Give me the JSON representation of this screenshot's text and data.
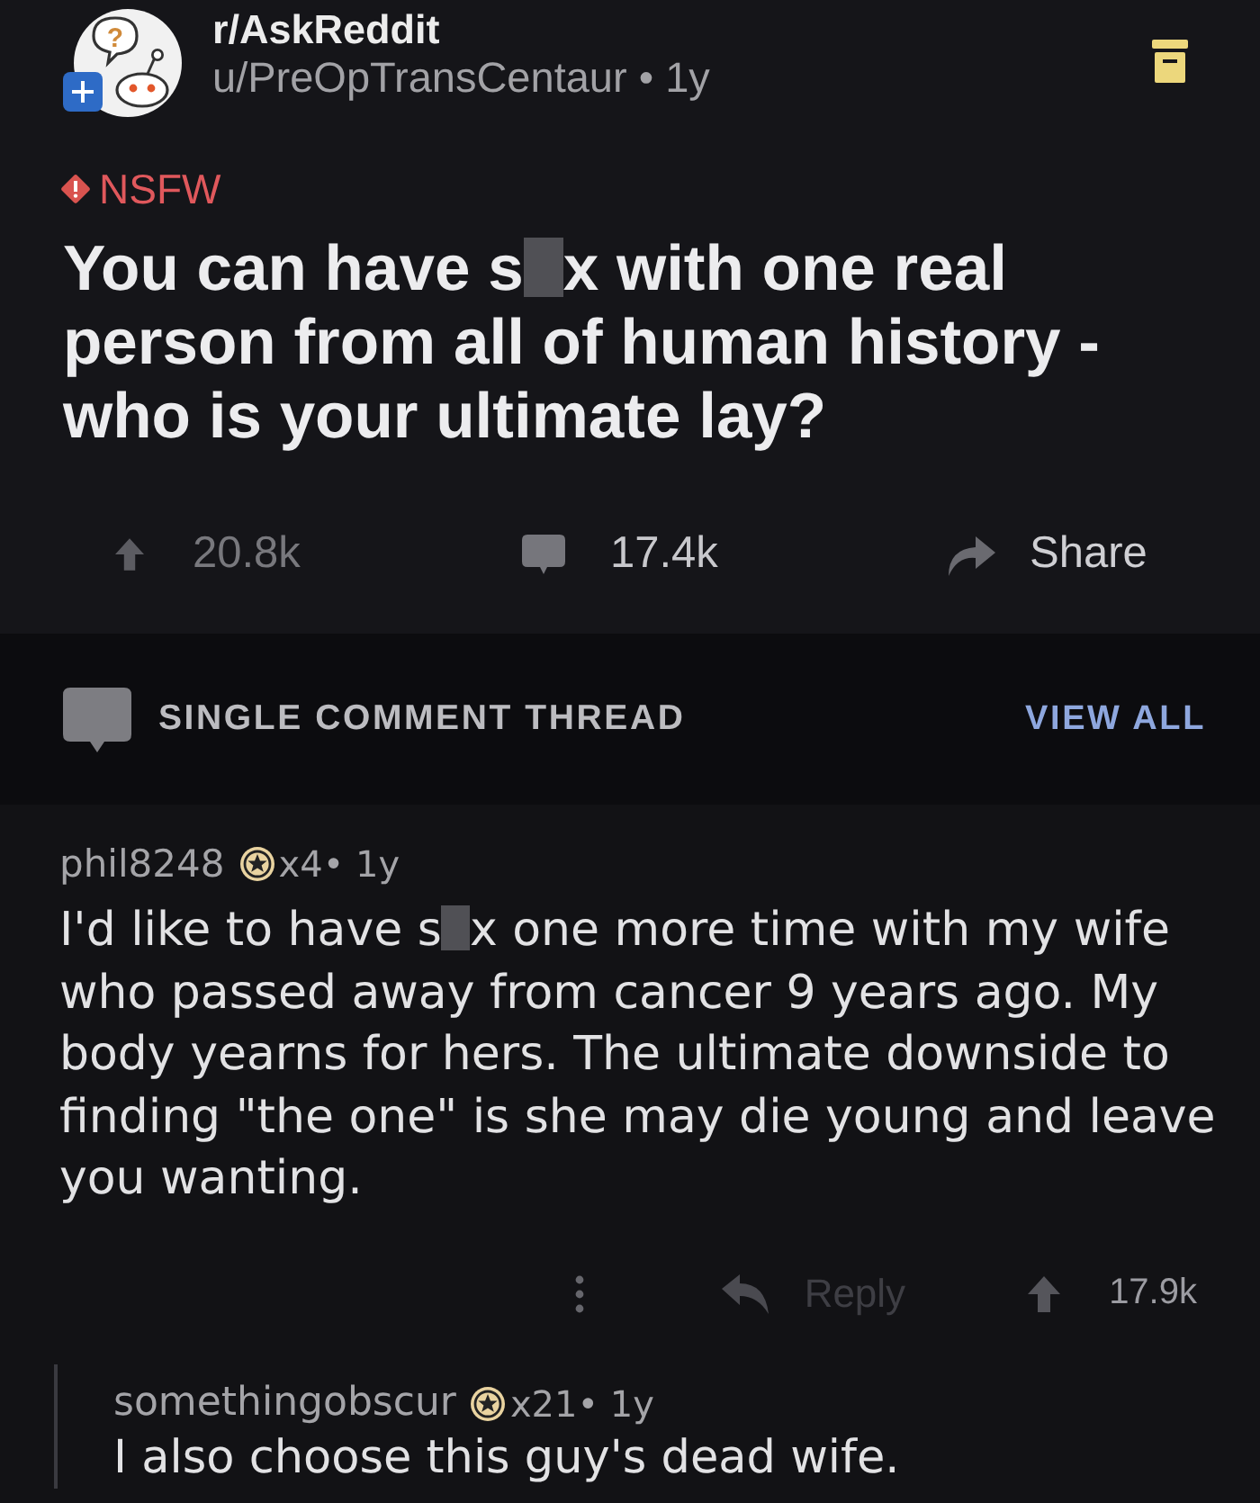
{
  "post": {
    "community": "r/AskReddit",
    "avatar_glyph": "?",
    "byline": "u/PreOpTransCentaur • 1y",
    "archived": true,
    "nsfw": true,
    "nsfw_label": "NSFW",
    "title": [
      {
        "kind": "text",
        "text": "You can have s"
      },
      {
        "kind": "censor"
      },
      {
        "kind": "text",
        "text": "x with one real person from all of human history - who is your ultimate lay?"
      }
    ]
  },
  "actions": {
    "upvotes": "20.8k",
    "comments": "17.4k",
    "share": "Share"
  },
  "thread_bar": {
    "label": "SINGLE COMMENT THREAD",
    "link": "VIEW ALL"
  },
  "comments": [
    {
      "author": "phil8248",
      "meta": "x4• 1y",
      "body": [
        {
          "kind": "text",
          "text": "I'd like to have s"
        },
        {
          "kind": "censor"
        },
        {
          "kind": "text",
          "text": "x one more time with my wife who passed away from cancer 9 years ago. My body yearns for hers. The ultimate downside to finding \"the one\" is she may die young and leave you wanting."
        }
      ],
      "reply": {
        "label": "Reply",
        "disabled": true
      },
      "score": "17.9k",
      "children": [
        {
          "author": "somethingobscur",
          "meta": "x21• 1y",
          "body": [
            {
              "kind": "text",
              "text": "I also choose this guy's dead wife."
            }
          ]
        }
      ]
    }
  ]
}
